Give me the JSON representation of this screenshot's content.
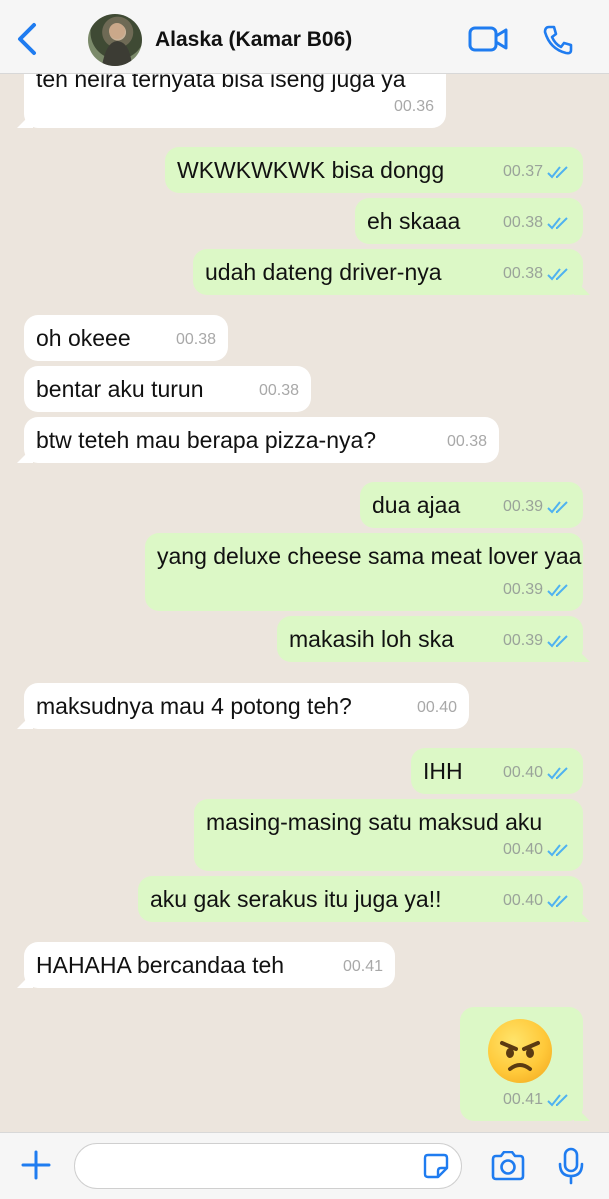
{
  "header": {
    "contact_name": "Alaska (Kamar B06)",
    "accent_color": "#1f7cf0"
  },
  "messages": [
    {
      "direction": "in",
      "text": "teh neira ternyata bisa iseng juga ya",
      "time": "00.36"
    },
    {
      "direction": "out",
      "text": "WKWKWKWK bisa dongg",
      "time": "00.37",
      "status": "read"
    },
    {
      "direction": "out",
      "text": "eh skaaa",
      "time": "00.38",
      "status": "read"
    },
    {
      "direction": "out",
      "text": "udah dateng driver-nya",
      "time": "00.38",
      "status": "read"
    },
    {
      "direction": "in",
      "text": "oh okeee",
      "time": "00.38"
    },
    {
      "direction": "in",
      "text": "bentar aku turun",
      "time": "00.38"
    },
    {
      "direction": "in",
      "text": "btw teteh mau berapa pizza-nya?",
      "time": "00.38"
    },
    {
      "direction": "out",
      "text": "dua ajaa",
      "time": "00.39",
      "status": "read"
    },
    {
      "direction": "out",
      "text": "yang deluxe cheese sama meat lover yaa",
      "time": "00.39",
      "status": "read"
    },
    {
      "direction": "out",
      "text": "makasih loh ska",
      "time": "00.39",
      "status": "read"
    },
    {
      "direction": "in",
      "text": "maksudnya mau 4 potong teh?",
      "time": "00.40"
    },
    {
      "direction": "out",
      "text": "IHH",
      "time": "00.40",
      "status": "read"
    },
    {
      "direction": "out",
      "text": "masing-masing satu maksud aku",
      "time": "00.40",
      "status": "read"
    },
    {
      "direction": "out",
      "text": "aku gak serakus itu juga ya!!",
      "time": "00.40",
      "status": "read"
    },
    {
      "direction": "in",
      "text": "HAHAHA bercandaa teh",
      "time": "00.41"
    },
    {
      "direction": "out",
      "text": "",
      "emoji": "angry-face",
      "time": "00.41",
      "status": "read"
    }
  ],
  "composer": {
    "placeholder": "",
    "value": ""
  },
  "colors": {
    "background": "#ece5dd",
    "incoming_bubble": "#ffffff",
    "outgoing_bubble": "#dcf8c6",
    "read_ticks": "#4fb2f0"
  }
}
